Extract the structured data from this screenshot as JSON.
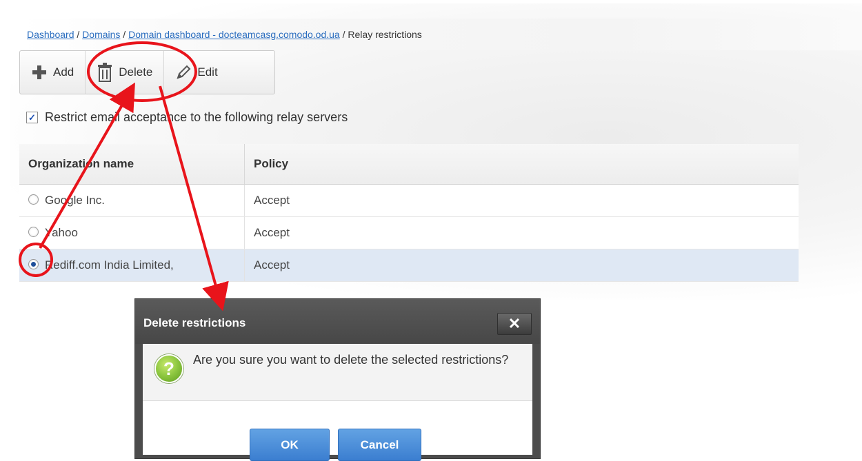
{
  "breadcrumb": {
    "items": [
      {
        "label": "Dashboard"
      },
      {
        "label": "Domains"
      },
      {
        "label": "Domain dashboard - docteamcasg.comodo.od.ua"
      },
      {
        "label": "Relay restrictions"
      }
    ],
    "separator": " / "
  },
  "toolbar": {
    "add_label": "Add",
    "delete_label": "Delete",
    "edit_label": "Edit"
  },
  "restrict": {
    "checked": true,
    "label": "Restrict email acceptance to the following relay servers"
  },
  "table": {
    "columns": [
      "Organization name",
      "Policy"
    ],
    "rows": [
      {
        "name": "Google Inc.",
        "policy": "Accept",
        "selected": false
      },
      {
        "name": "Yahoo",
        "policy": "Accept",
        "selected": false
      },
      {
        "name": "Rediff.com India Limited,",
        "policy": "Accept",
        "selected": true
      }
    ]
  },
  "dialog": {
    "title": "Delete restrictions",
    "close_label": "✕",
    "message": "Are you sure you want to delete the selected restrictions?",
    "ok_label": "OK",
    "cancel_label": "Cancel",
    "icon": "question-icon"
  },
  "colors": {
    "link": "#2a6dbf",
    "selected_row": "#dfe8f4",
    "dialog_header": "#4c4c4c",
    "button_primary": "#3b7ed0",
    "annotation": "#e8141b"
  }
}
